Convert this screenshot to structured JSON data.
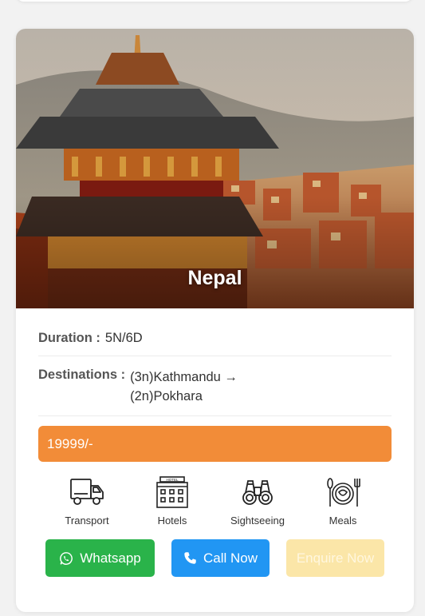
{
  "card": {
    "destination_name": "Nepal",
    "duration_label": "Duration :",
    "duration_value": "5N/6D",
    "destinations_label": "Destinations :",
    "destinations": [
      "(3n)Kathmandu →",
      "(2n)Pokhara"
    ],
    "price": "19999/-",
    "amenities": [
      {
        "label": "Transport",
        "icon": "truck-icon"
      },
      {
        "label": "Hotels",
        "icon": "hotel-icon"
      },
      {
        "label": "Sightseeing",
        "icon": "binoculars-icon"
      },
      {
        "label": "Meals",
        "icon": "meals-icon"
      }
    ],
    "hotel_sign": "HOTEL",
    "buttons": {
      "whatsapp": "Whatsapp",
      "call": "Call Now",
      "enquire": "Enquire Now"
    }
  },
  "colors": {
    "price_bar": "#f28c38",
    "whatsapp": "#2ab34a",
    "call": "#2196f3",
    "enquire": "#fbe6a8"
  }
}
